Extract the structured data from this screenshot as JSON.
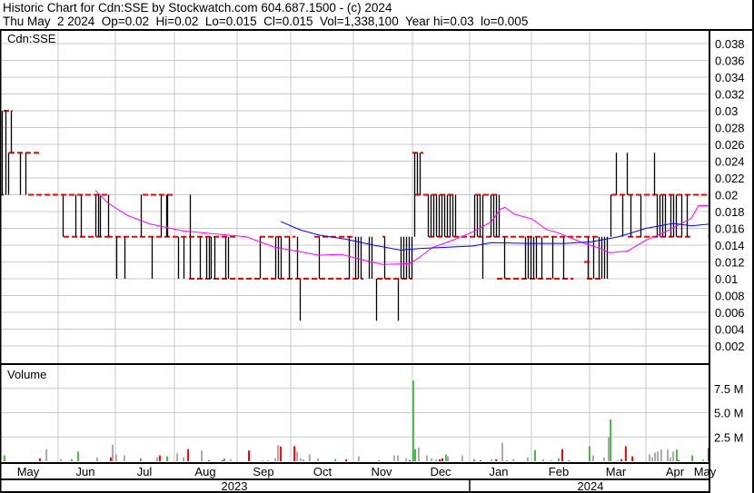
{
  "header": {
    "title": "Historic Chart for Cdn:SSE by Stockwatch.com 604.687.1500 - (c) 2024",
    "summary": "Thu May  2 2024  Op=0.02  Hi=0.02  Lo=0.015  Cl=0.015  Vol=1,338,100  Year hi=0.03  lo=0.005"
  },
  "chart_data": {
    "type": "ohlc",
    "symbol_label": "Cdn:SSE",
    "volume_label": "Volume",
    "x_unit": "trading day index (0 = early May 2023, ~260 = May 2 2024)",
    "price_ticks": [
      "0.038",
      "0.036",
      "0.034",
      "0.032",
      "0.03",
      "0.028",
      "0.026",
      "0.024",
      "0.022",
      "0.02",
      "0.018",
      "0.016",
      "0.014",
      "0.012",
      "0.01",
      "0.008",
      "0.006",
      "0.004",
      "0.002"
    ],
    "price_ylim": [
      0,
      0.04
    ],
    "volume_ticks": [
      "7.5 M",
      "5.0 M",
      "2.5 M"
    ],
    "volume_ylim": [
      0,
      10
    ],
    "months": [
      "May",
      "Jun",
      "Jul",
      "Aug",
      "Sep",
      "Oct",
      "Nov",
      "Dec",
      "Jan",
      "Feb",
      "Mar",
      "Apr",
      "May"
    ],
    "years": [
      "2023",
      "2024"
    ],
    "colors": {
      "bar": "#000000",
      "close": "#ff0000",
      "ma_short": "#ff00ff",
      "ma_long": "#0000ff",
      "vol_up": "#44bb44",
      "vol_down": "#ff0000",
      "vol_flat": "#aaaaaa",
      "grid": "#c8c8c8"
    },
    "bars_day_lo_hi": [
      [
        0.3,
        0.02,
        0.03
      ],
      [
        1.7,
        0.02,
        0.03
      ],
      [
        2.7,
        0.02,
        0.025
      ],
      [
        3.7,
        0.025,
        0.03
      ],
      [
        7,
        0.02,
        0.025
      ],
      [
        9,
        0.02,
        0.025
      ],
      [
        22.7,
        0.015,
        0.02
      ],
      [
        27.3,
        0.015,
        0.02
      ],
      [
        29.3,
        0.015,
        0.02
      ],
      [
        34.7,
        0.015,
        0.02
      ],
      [
        35.7,
        0.015,
        0.02
      ],
      [
        36.3,
        0.015,
        0.02
      ],
      [
        39.3,
        0.015,
        0.02
      ],
      [
        42.3,
        0.01,
        0.015
      ],
      [
        45.3,
        0.01,
        0.015
      ],
      [
        51.3,
        0.015,
        0.02
      ],
      [
        55.3,
        0.01,
        0.015
      ],
      [
        58.7,
        0.015,
        0.02
      ],
      [
        60.7,
        0.015,
        0.02
      ],
      [
        61,
        0.015,
        0.02
      ],
      [
        65,
        0.01,
        0.015
      ],
      [
        67,
        0.01,
        0.015
      ],
      [
        69.3,
        0.01,
        0.02
      ],
      [
        73,
        0.01,
        0.015
      ],
      [
        75.3,
        0.01,
        0.015
      ],
      [
        76.3,
        0.01,
        0.015
      ],
      [
        77,
        0.01,
        0.015
      ],
      [
        78.3,
        0.01,
        0.015
      ],
      [
        82.3,
        0.01,
        0.015
      ],
      [
        83.3,
        0.01,
        0.015
      ],
      [
        95,
        0.01,
        0.015
      ],
      [
        100.7,
        0.01,
        0.015
      ],
      [
        101.7,
        0.01,
        0.015
      ],
      [
        102.7,
        0.01,
        0.015
      ],
      [
        105.7,
        0.01,
        0.015
      ],
      [
        108.7,
        0.01,
        0.015
      ],
      [
        109.7,
        0.005,
        0.01
      ],
      [
        116.7,
        0.01,
        0.015
      ],
      [
        127.7,
        0.01,
        0.015
      ],
      [
        130,
        0.01,
        0.015
      ],
      [
        131,
        0.01,
        0.015
      ],
      [
        132,
        0.01,
        0.015
      ],
      [
        135,
        0.01,
        0.015
      ],
      [
        136,
        0.01,
        0.015
      ],
      [
        137.7,
        0.005,
        0.01
      ],
      [
        140.7,
        0.01,
        0.015
      ],
      [
        145.7,
        0.005,
        0.01
      ],
      [
        146.7,
        0.01,
        0.015
      ],
      [
        147.7,
        0.01,
        0.015
      ],
      [
        148.7,
        0.01,
        0.015
      ],
      [
        149.7,
        0.01,
        0.015
      ],
      [
        150.7,
        0.01,
        0.015
      ],
      [
        151.7,
        0.015,
        0.025
      ],
      [
        152.7,
        0.02,
        0.025
      ],
      [
        153.7,
        0.02,
        0.025
      ],
      [
        156.7,
        0.015,
        0.02
      ],
      [
        157.7,
        0.015,
        0.02
      ],
      [
        158.7,
        0.015,
        0.02
      ],
      [
        159.7,
        0.015,
        0.02
      ],
      [
        160.7,
        0.015,
        0.02
      ],
      [
        161.7,
        0.015,
        0.02
      ],
      [
        162.7,
        0.015,
        0.02
      ],
      [
        163.7,
        0.015,
        0.02
      ],
      [
        164.7,
        0.015,
        0.02
      ],
      [
        165.7,
        0.015,
        0.02
      ],
      [
        166.7,
        0.015,
        0.02
      ],
      [
        173.7,
        0.015,
        0.02
      ],
      [
        174.7,
        0.015,
        0.02
      ],
      [
        175.7,
        0.015,
        0.02
      ],
      [
        176.7,
        0.01,
        0.02
      ],
      [
        179.7,
        0.015,
        0.02
      ],
      [
        180.7,
        0.015,
        0.02
      ],
      [
        181.7,
        0.015,
        0.02
      ],
      [
        182.7,
        0.015,
        0.02
      ],
      [
        184.7,
        0.01,
        0.015
      ],
      [
        192.3,
        0.01,
        0.015
      ],
      [
        193.3,
        0.01,
        0.015
      ],
      [
        194.3,
        0.01,
        0.015
      ],
      [
        195.3,
        0.01,
        0.015
      ],
      [
        196.3,
        0.01,
        0.015
      ],
      [
        198.3,
        0.01,
        0.015
      ],
      [
        202.3,
        0.01,
        0.015
      ],
      [
        206.3,
        0.01,
        0.015
      ],
      [
        215.3,
        0.01,
        0.015
      ],
      [
        217.3,
        0.01,
        0.015
      ],
      [
        219.3,
        0.01,
        0.015
      ],
      [
        220.3,
        0.01,
        0.015
      ],
      [
        221.3,
        0.01,
        0.015
      ],
      [
        222.3,
        0.01,
        0.015
      ],
      [
        223.7,
        0.015,
        0.02
      ],
      [
        225.7,
        0.02,
        0.025
      ],
      [
        228,
        0.015,
        0.02
      ],
      [
        229.7,
        0.02,
        0.025
      ],
      [
        231,
        0.015,
        0.02
      ],
      [
        234.7,
        0.015,
        0.02
      ],
      [
        239.7,
        0.02,
        0.025
      ],
      [
        240.7,
        0.015,
        0.02
      ],
      [
        241.7,
        0.015,
        0.02
      ],
      [
        242.7,
        0.015,
        0.02
      ],
      [
        243.7,
        0.015,
        0.02
      ],
      [
        245.7,
        0.015,
        0.02
      ],
      [
        246.7,
        0.015,
        0.02
      ],
      [
        247.7,
        0.015,
        0.02
      ],
      [
        249.7,
        0.015,
        0.02
      ],
      [
        251.7,
        0.015,
        0.02
      ],
      [
        259.7,
        0.015,
        0.02
      ]
    ],
    "close_segments_day_from_to_price": [
      [
        0,
        1,
        0.02
      ],
      [
        1,
        4.3,
        0.03
      ],
      [
        3,
        14,
        0.025
      ],
      [
        10,
        40,
        0.02
      ],
      [
        23,
        40,
        0.015
      ],
      [
        39,
        87,
        0.015
      ],
      [
        52,
        63,
        0.02
      ],
      [
        69,
        133,
        0.01
      ],
      [
        95,
        108,
        0.015
      ],
      [
        115,
        130,
        0.015
      ],
      [
        138,
        151,
        0.01
      ],
      [
        140,
        141,
        0.015
      ],
      [
        151,
        155,
        0.025
      ],
      [
        152,
        167,
        0.02
      ],
      [
        157,
        220,
        0.015
      ],
      [
        174,
        183,
        0.02
      ],
      [
        182,
        210,
        0.01
      ],
      [
        214,
        216,
        0.012
      ],
      [
        215,
        221,
        0.01
      ],
      [
        224,
        260,
        0.02
      ],
      [
        230,
        253,
        0.015
      ],
      [
        259.5,
        260,
        0.015
      ]
    ],
    "ma_short_day_price": [
      [
        34.7,
        0.0205
      ],
      [
        39.3,
        0.019
      ],
      [
        46.7,
        0.0175
      ],
      [
        55,
        0.0165
      ],
      [
        66.7,
        0.0157
      ],
      [
        80,
        0.0153
      ],
      [
        90,
        0.015
      ],
      [
        100,
        0.0138
      ],
      [
        110,
        0.0132
      ],
      [
        116.7,
        0.0128
      ],
      [
        125,
        0.0129
      ],
      [
        133.3,
        0.0122
      ],
      [
        140,
        0.0117
      ],
      [
        150,
        0.0118
      ],
      [
        153.3,
        0.0125
      ],
      [
        158.3,
        0.0137
      ],
      [
        166.7,
        0.0147
      ],
      [
        173.3,
        0.0156
      ],
      [
        180,
        0.0168
      ],
      [
        183.3,
        0.0183
      ],
      [
        185,
        0.0185
      ],
      [
        188.3,
        0.0177
      ],
      [
        195,
        0.0171
      ],
      [
        200,
        0.0159
      ],
      [
        205,
        0.0154
      ],
      [
        213.3,
        0.0143
      ],
      [
        220,
        0.0136
      ],
      [
        223.3,
        0.0131
      ],
      [
        230,
        0.0133
      ],
      [
        236.7,
        0.0146
      ],
      [
        243.3,
        0.0155
      ],
      [
        253.3,
        0.0172
      ],
      [
        256,
        0.0187
      ],
      [
        259.7,
        0.0187
      ]
    ],
    "ma_long_day_price": [
      [
        102.7,
        0.0168
      ],
      [
        110,
        0.0158
      ],
      [
        116.7,
        0.0152
      ],
      [
        126.7,
        0.0147
      ],
      [
        136.7,
        0.014
      ],
      [
        146.7,
        0.0134
      ],
      [
        153.3,
        0.0136
      ],
      [
        173.3,
        0.0139
      ],
      [
        180,
        0.0143
      ],
      [
        193.3,
        0.0142
      ],
      [
        206.7,
        0.0142
      ],
      [
        216.7,
        0.0144
      ],
      [
        226.7,
        0.015
      ],
      [
        236.7,
        0.016
      ],
      [
        246.7,
        0.0166
      ],
      [
        253.3,
        0.0163
      ],
      [
        259.7,
        0.0165
      ]
    ],
    "volume_day_millions_color": [
      [
        1.3,
        0.6,
        "g"
      ],
      [
        14.3,
        0.3,
        "r"
      ],
      [
        16.7,
        1.25,
        "k"
      ],
      [
        22,
        0.2,
        "k"
      ],
      [
        26,
        0.2,
        "g"
      ],
      [
        28.3,
        1.0,
        "g"
      ],
      [
        35.3,
        0.4,
        "k"
      ],
      [
        40.3,
        0.4,
        "r"
      ],
      [
        41,
        1.7,
        "k"
      ],
      [
        42.3,
        0.7,
        "k"
      ],
      [
        45.3,
        0.6,
        "k"
      ],
      [
        51.3,
        0.3,
        "g"
      ],
      [
        57.3,
        0.4,
        "k"
      ],
      [
        58.3,
        0.6,
        "r"
      ],
      [
        61,
        0.5,
        "g"
      ],
      [
        64.7,
        0.8,
        "k"
      ],
      [
        67,
        0.4,
        "k"
      ],
      [
        68.7,
        1.25,
        "r"
      ],
      [
        73.7,
        1.1,
        "k"
      ],
      [
        76.3,
        0.1,
        "r"
      ],
      [
        81.3,
        0.1,
        "r"
      ],
      [
        82,
        0.3,
        "g"
      ],
      [
        84.3,
        0.2,
        "k"
      ],
      [
        91,
        1.1,
        "r"
      ],
      [
        96,
        0.1,
        "k"
      ],
      [
        98,
        0.1,
        "k"
      ],
      [
        100.7,
        0.3,
        "k"
      ],
      [
        101.7,
        1.65,
        "k"
      ],
      [
        102.7,
        1.5,
        "r"
      ],
      [
        107.7,
        1.55,
        "r"
      ],
      [
        108.7,
        0.95,
        "k"
      ],
      [
        110,
        0.3,
        "k"
      ],
      [
        111,
        0.2,
        "k"
      ],
      [
        113.3,
        0.7,
        "k"
      ],
      [
        116.3,
        0.3,
        "k"
      ],
      [
        122.7,
        0.2,
        "g"
      ],
      [
        126.7,
        0.2,
        "r"
      ],
      [
        131.3,
        0.5,
        "k"
      ],
      [
        138.7,
        0.1,
        "g"
      ],
      [
        144.3,
        0.6,
        "k"
      ],
      [
        145.7,
        0.6,
        "k"
      ],
      [
        148.7,
        0.3,
        "k"
      ],
      [
        150,
        0.1,
        "r"
      ],
      [
        151.3,
        8.3,
        "g"
      ],
      [
        152,
        1.25,
        "g"
      ],
      [
        153.3,
        1.4,
        "k"
      ],
      [
        156.3,
        0.6,
        "k"
      ],
      [
        158,
        0.3,
        "k"
      ],
      [
        159.7,
        0.2,
        "k"
      ],
      [
        161,
        0.2,
        "r"
      ],
      [
        162,
        0.3,
        "r"
      ],
      [
        163.3,
        0.7,
        "g"
      ],
      [
        164,
        0.5,
        "k"
      ],
      [
        169.3,
        0.6,
        "k"
      ],
      [
        173.7,
        0.2,
        "g"
      ],
      [
        176,
        0.1,
        "r"
      ],
      [
        180,
        0.2,
        "k"
      ],
      [
        181.7,
        0.2,
        "r"
      ],
      [
        184,
        1.9,
        "k"
      ],
      [
        185.7,
        0.1,
        "g"
      ],
      [
        188,
        0.2,
        "k"
      ],
      [
        193.3,
        0.4,
        "k"
      ],
      [
        196,
        1.15,
        "g"
      ],
      [
        199,
        0.2,
        "k"
      ],
      [
        202,
        0.1,
        "k"
      ],
      [
        204.7,
        0.3,
        "g"
      ],
      [
        206,
        1.25,
        "r"
      ],
      [
        208.3,
        0.1,
        "g"
      ],
      [
        216,
        1.55,
        "g"
      ],
      [
        217.3,
        0.6,
        "k"
      ],
      [
        221.3,
        0.4,
        "k"
      ],
      [
        223,
        2.5,
        "k"
      ],
      [
        223.7,
        4.3,
        "g"
      ],
      [
        226.3,
        0.1,
        "k"
      ],
      [
        227.7,
        0.2,
        "r"
      ],
      [
        229.3,
        1.55,
        "r"
      ],
      [
        231.7,
        0.5,
        "r"
      ],
      [
        238,
        0.7,
        "k"
      ],
      [
        239,
        0.4,
        "k"
      ],
      [
        240,
        0.9,
        "k"
      ],
      [
        241,
        1.0,
        "k"
      ],
      [
        242.3,
        1.2,
        "k"
      ],
      [
        244.7,
        1.2,
        "k"
      ],
      [
        245.7,
        0.4,
        "k"
      ],
      [
        246.7,
        1.0,
        "k"
      ],
      [
        248,
        1.2,
        "g"
      ],
      [
        248.7,
        0.1,
        "r"
      ],
      [
        253.7,
        0.6,
        "g"
      ],
      [
        257.7,
        0.2,
        "k"
      ],
      [
        259.7,
        1.35,
        "r"
      ]
    ]
  }
}
